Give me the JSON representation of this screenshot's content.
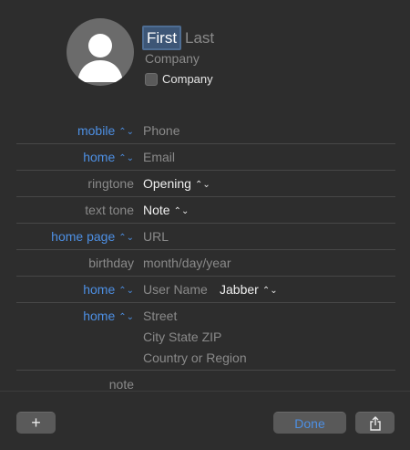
{
  "header": {
    "first_name": "First",
    "last_name": "Last",
    "company_placeholder": "Company",
    "company_checkbox_label": "Company"
  },
  "rows": [
    {
      "label": "mobile",
      "label_color": "blue",
      "value": "Phone",
      "value_style": "placeholder"
    },
    {
      "label": "home",
      "label_color": "blue",
      "value": "Email",
      "value_style": "placeholder"
    },
    {
      "label": "ringtone",
      "label_color": "gray",
      "value": "Opening",
      "value_style": "strong"
    },
    {
      "label": "text tone",
      "label_color": "gray",
      "value": "Note",
      "value_style": "strong"
    },
    {
      "label": "home page",
      "label_color": "blue",
      "value": "URL",
      "value_style": "placeholder"
    },
    {
      "label": "birthday",
      "label_color": "gray",
      "value": "month/day/year",
      "value_style": "placeholder"
    },
    {
      "label": "home",
      "label_color": "blue",
      "value": "User Name",
      "value_style": "placeholder",
      "service": "Jabber"
    },
    {
      "label": "home",
      "label_color": "blue",
      "address_lines": [
        "Street",
        "City State ZIP",
        "Country or Region"
      ]
    },
    {
      "label": "note",
      "label_color": "gray",
      "value": ""
    }
  ],
  "buttons": {
    "add_label": "+",
    "done_label": "Done",
    "share_icon": "share-icon"
  },
  "colors": {
    "background": "#2d2d2d",
    "accent_blue": "#4d8fe3",
    "placeholder_gray": "#8a8a8a",
    "selection": "#3d5676"
  }
}
